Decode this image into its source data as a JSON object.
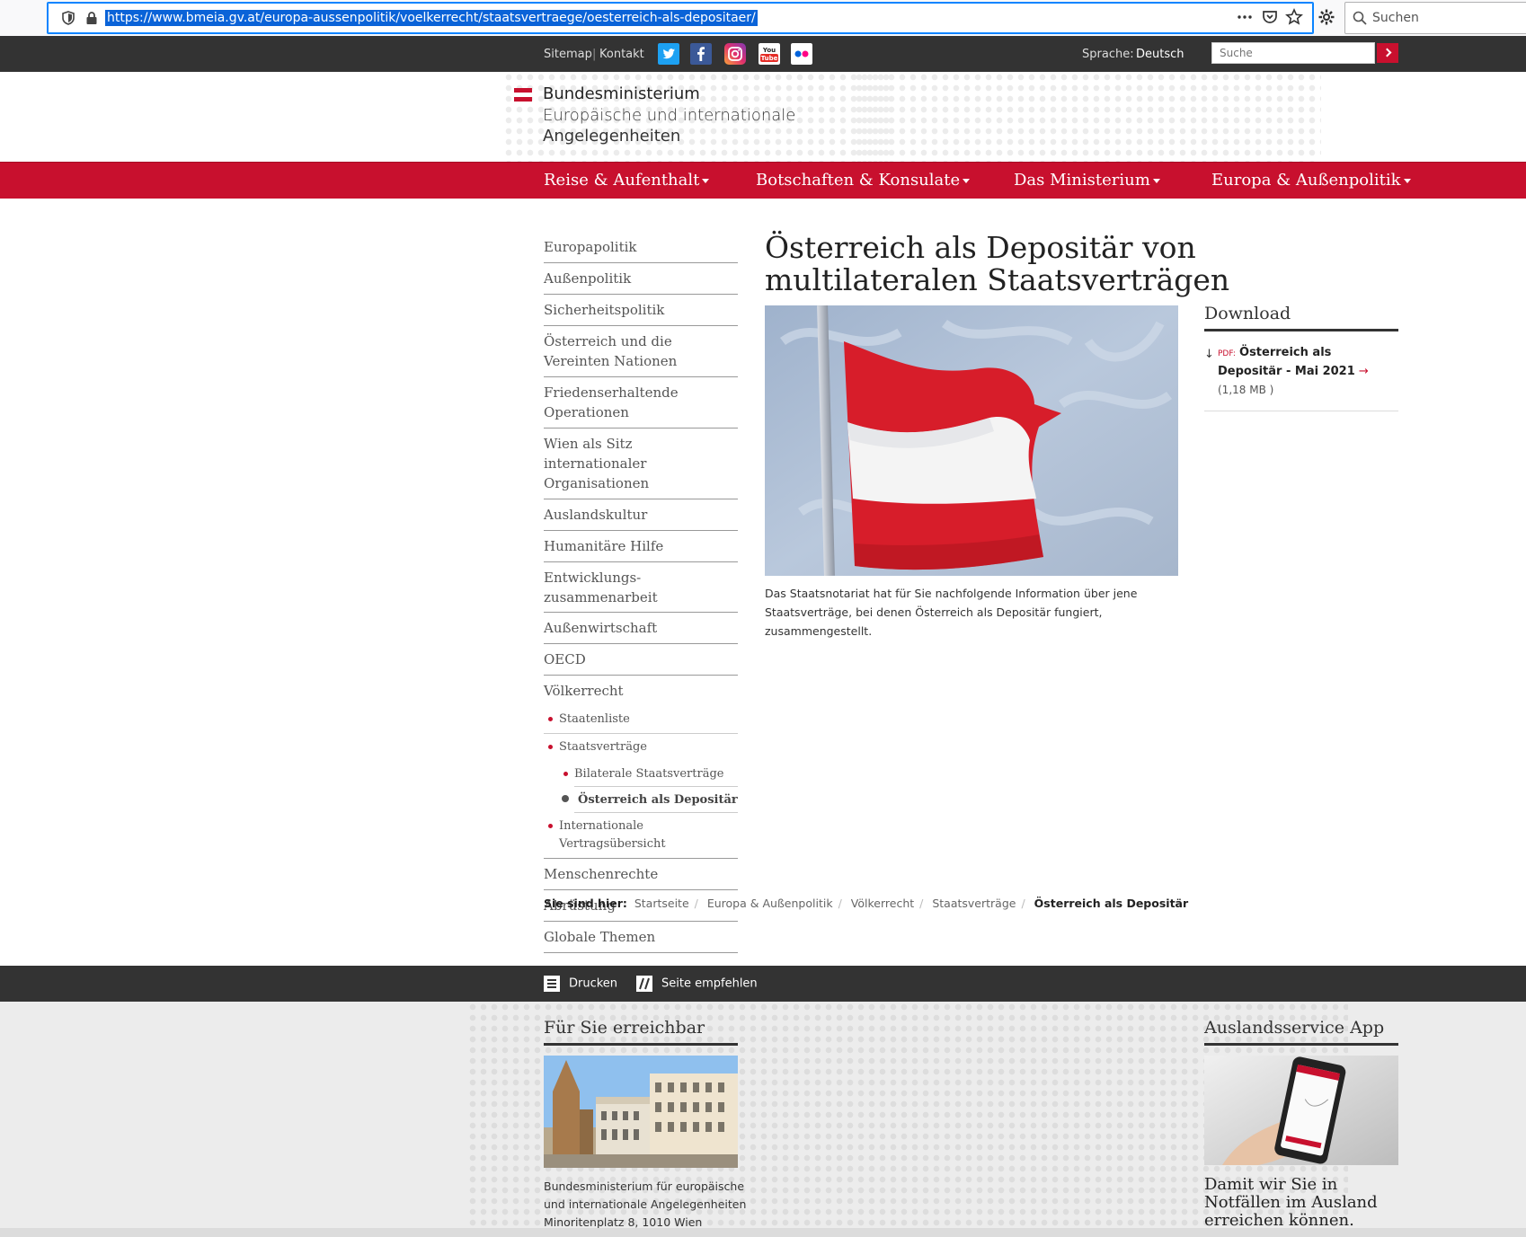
{
  "browser": {
    "url": "https://www.bmeia.gv.at/europa-aussenpolitik/voelkerrecht/staatsvertraege/oesterreich-als-depositaer/",
    "search_placeholder": "Suchen"
  },
  "topbar": {
    "sitemap": "Sitemap",
    "separator": "|",
    "contact": "Kontakt",
    "language_label": "Sprache:",
    "language_value": "Deutsch",
    "search_placeholder": "Suche",
    "social": [
      "twitter-icon",
      "facebook-icon",
      "instagram-icon",
      "youtube-icon",
      "flickr-icon"
    ],
    "youtube_you": "You",
    "youtube_tube": "Tube"
  },
  "header": {
    "logo_line1": "Bundesministerium",
    "logo_line2": "Europäische und internationale",
    "logo_line3": "Angelegenheiten"
  },
  "nav": {
    "items": [
      {
        "label": "Reise & Aufenthalt"
      },
      {
        "label": "Botschaften & Konsulate"
      },
      {
        "label": "Das Ministerium"
      },
      {
        "label": "Europa & Außenpolitik"
      }
    ]
  },
  "sidebar": {
    "items": [
      {
        "label": "Europapolitik"
      },
      {
        "label": "Außenpolitik"
      },
      {
        "label": "Sicherheitspolitik"
      },
      {
        "label": "Österreich und die Vereinten Nationen"
      },
      {
        "label": "Friedenserhaltende Operationen"
      },
      {
        "label": "Wien als Sitz internationaler Organisationen"
      },
      {
        "label": "Auslandskultur"
      },
      {
        "label": "Humanitäre Hilfe"
      },
      {
        "label": "Entwicklungs-zusammenarbeit"
      },
      {
        "label": "Außenwirtschaft"
      },
      {
        "label": "OECD"
      },
      {
        "label": "Völkerrecht"
      }
    ],
    "sub": {
      "staatenliste": "Staatenliste",
      "staatsvertraege": "Staatsverträge",
      "bilaterale": "Bilaterale Staatsverträge",
      "depositaer": "Österreich als Depositär",
      "international": "Internationale Vertragsübersicht"
    },
    "after": [
      {
        "label": "Menschenrechte"
      },
      {
        "label": "Abrüstung"
      },
      {
        "label": "Globale Themen"
      }
    ]
  },
  "content": {
    "title": "Österreich als Depositär von multilateralen Staatsverträgen",
    "intro": "Das Staatsnotariat hat für Sie nachfolgende Information über jene Staatsverträge, bei denen Österreich als Depositär fungiert, zusammengestellt."
  },
  "download": {
    "title": "Download",
    "arrow": "↓",
    "badge": "PDF:",
    "link": "Österreich als Depositär - Mai 2021",
    "link_arrow": "→",
    "size": "(1,18 MB )"
  },
  "breadcrumb": {
    "label": "Sie sind hier:",
    "items": [
      "Startseite",
      "Europa & Außenpolitik",
      "Völkerrecht",
      "Staatsverträge"
    ],
    "separator": "/",
    "current": "Österreich als Depositär"
  },
  "footbar": {
    "print": "Drucken",
    "recommend": "Seite empfehlen"
  },
  "footer": {
    "left_title": "Für Sie erreichbar",
    "address_line1": "Bundesministerium für europäische",
    "address_line2": "und internationale Angelegenheiten",
    "address_line3": "Minoritenplatz 8, 1010 Wien",
    "right_title": "Auslandsservice App",
    "app_text": "Damit wir Sie in Notfällen im Ausland erreichen können."
  },
  "colors": {
    "brand_red": "#c8102e",
    "dark_bar": "#333333"
  }
}
